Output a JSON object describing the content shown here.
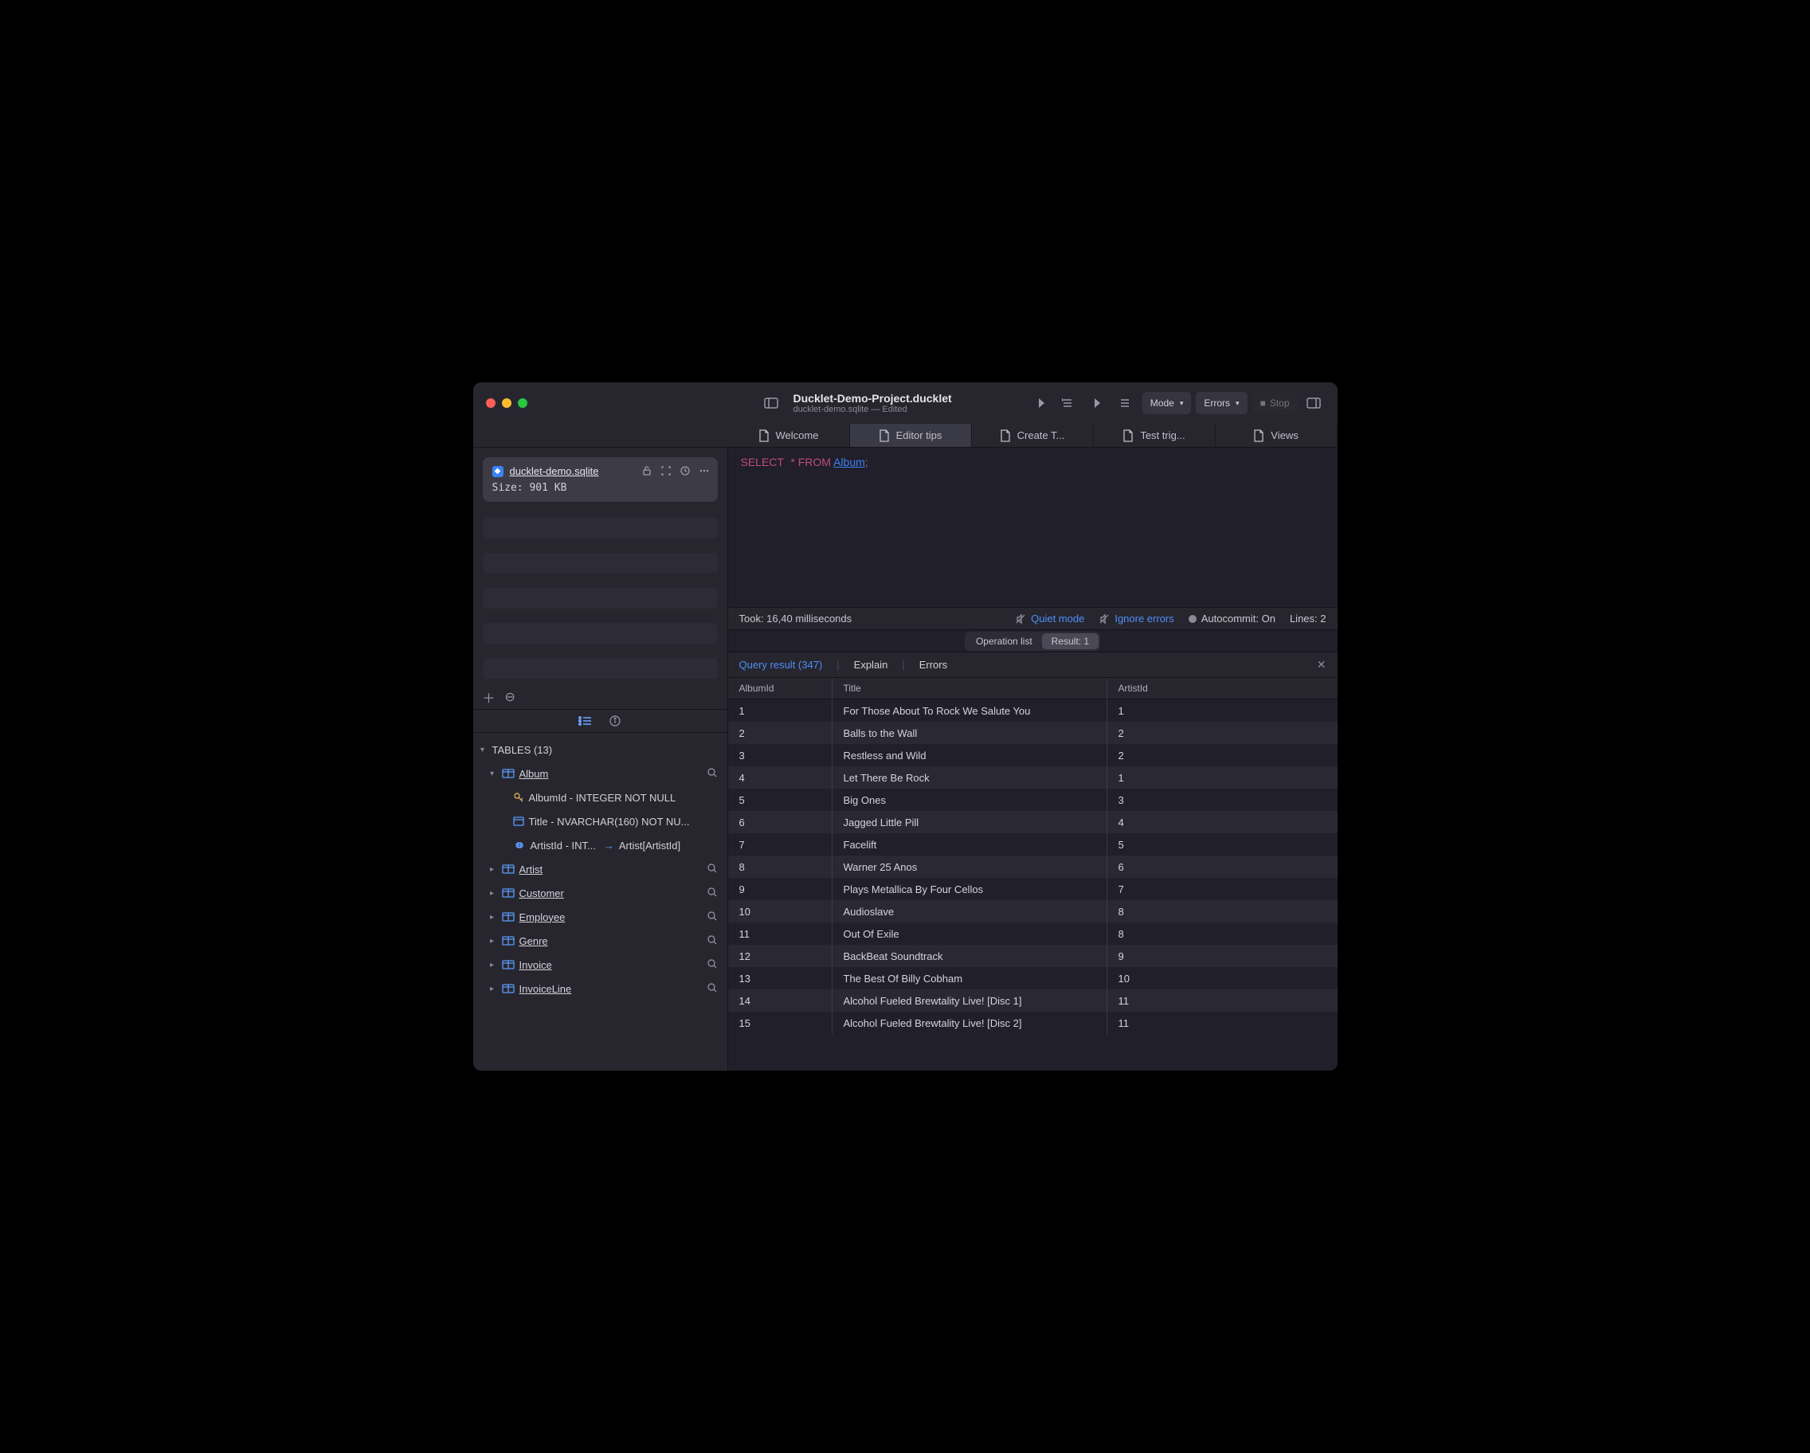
{
  "window": {
    "title": "Ducklet-Demo-Project.ducklet",
    "subtitle": "ducklet-demo.sqlite — Edited"
  },
  "toolbar": {
    "mode_label": "Mode",
    "errors_label": "Errors",
    "stop_label": "Stop"
  },
  "tabs": [
    "Welcome",
    "Editor tips",
    "Create T...",
    "Test trig...",
    "Views"
  ],
  "sidebar": {
    "db_name": "ducklet-demo.sqlite",
    "db_size": "Size: 901 KB",
    "tables_header": "TABLES (13)",
    "album_table": "Album",
    "album_cols": {
      "albumid": "AlbumId - INTEGER NOT NULL",
      "title": "Title - NVARCHAR(160) NOT NU...",
      "artistid_l": "ArtistId - INT...",
      "artistid_r": "Artist[ArtistId]"
    },
    "tables_rest": [
      "Artist",
      "Customer",
      "Employee",
      "Genre",
      "Invoice",
      "InvoiceLine"
    ]
  },
  "editor": {
    "sql_select": "SELECT",
    "sql_star": "*",
    "sql_from": "FROM",
    "sql_table": "Album",
    "sql_semi": ";"
  },
  "status": {
    "took": "Took: 16,40 milliseconds",
    "quiet": "Quiet mode",
    "ignore": "Ignore errors",
    "autocommit": "Autocommit: On",
    "lines": "Lines: 2"
  },
  "pill": {
    "op": "Operation list",
    "res": "Result: 1"
  },
  "result_tabs": {
    "query": "Query result (347)",
    "explain": "Explain",
    "errors": "Errors"
  },
  "columns": [
    "AlbumId",
    "Title",
    "ArtistId"
  ],
  "rows": [
    {
      "album_id": "1",
      "title": "For Those About To Rock We Salute You",
      "artist_id": "1"
    },
    {
      "album_id": "2",
      "title": "Balls to the Wall",
      "artist_id": "2"
    },
    {
      "album_id": "3",
      "title": "Restless and Wild",
      "artist_id": "2"
    },
    {
      "album_id": "4",
      "title": "Let There Be Rock",
      "artist_id": "1"
    },
    {
      "album_id": "5",
      "title": "Big Ones",
      "artist_id": "3"
    },
    {
      "album_id": "6",
      "title": "Jagged Little Pill",
      "artist_id": "4"
    },
    {
      "album_id": "7",
      "title": "Facelift",
      "artist_id": "5"
    },
    {
      "album_id": "8",
      "title": "Warner 25 Anos",
      "artist_id": "6"
    },
    {
      "album_id": "9",
      "title": "Plays Metallica By Four Cellos",
      "artist_id": "7"
    },
    {
      "album_id": "10",
      "title": "Audioslave",
      "artist_id": "8"
    },
    {
      "album_id": "11",
      "title": "Out Of Exile",
      "artist_id": "8"
    },
    {
      "album_id": "12",
      "title": "BackBeat Soundtrack",
      "artist_id": "9"
    },
    {
      "album_id": "13",
      "title": "The Best Of Billy Cobham",
      "artist_id": "10"
    },
    {
      "album_id": "14",
      "title": "Alcohol Fueled Brewtality Live! [Disc 1]",
      "artist_id": "11"
    },
    {
      "album_id": "15",
      "title": "Alcohol Fueled Brewtality Live! [Disc 2]",
      "artist_id": "11"
    }
  ]
}
